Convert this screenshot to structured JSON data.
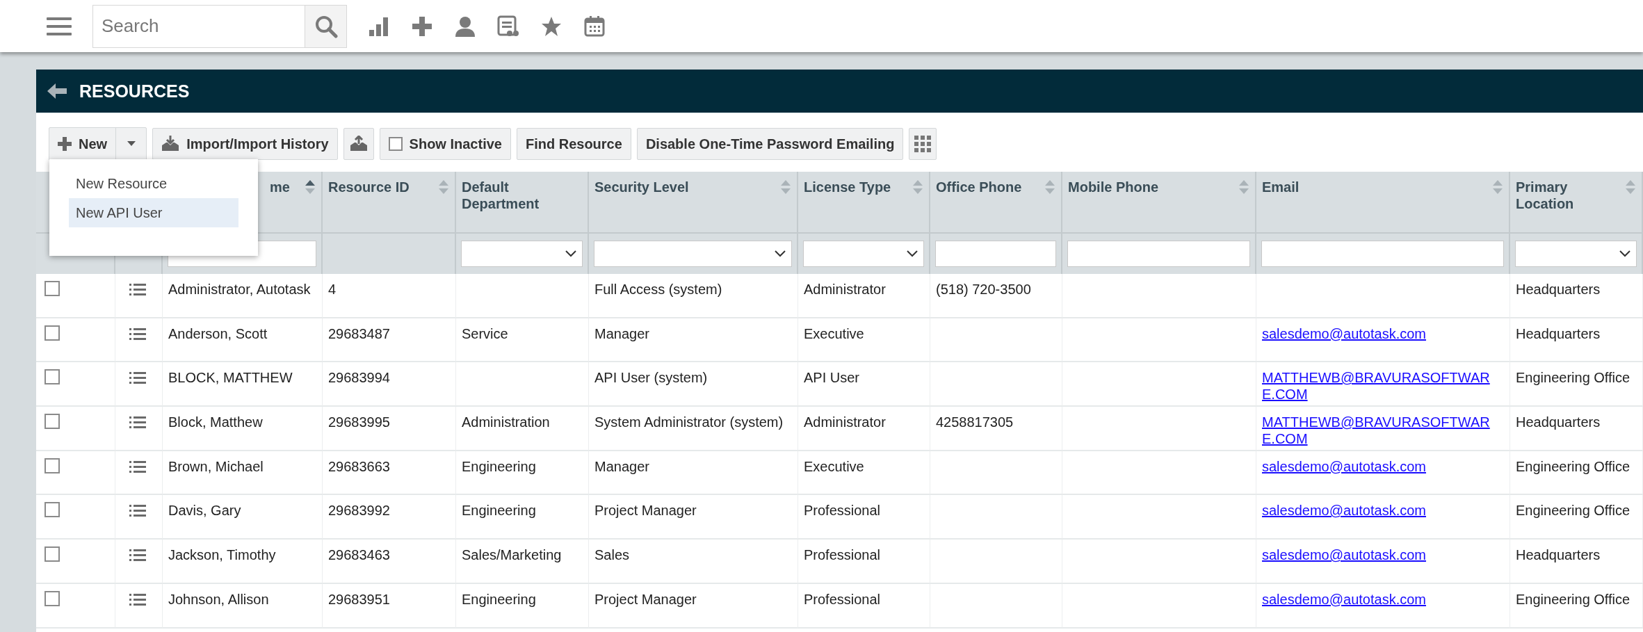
{
  "topbar": {
    "search": {
      "placeholder": "Search"
    }
  },
  "panel": {
    "title": "RESOURCES"
  },
  "toolbar": {
    "new_button": {
      "label": "New"
    },
    "import_button": {
      "label": "Import/Import History"
    },
    "show_inactive": {
      "label": "Show Inactive",
      "checked": false
    },
    "find_button": {
      "label": "Find Resource"
    },
    "disable_button": {
      "label": "Disable One-Time Password Emailing"
    }
  },
  "new_menu": {
    "open": true,
    "items": [
      {
        "label": "New Resource",
        "selected": false
      },
      {
        "label": "New API User",
        "selected": true
      }
    ]
  },
  "table": {
    "columns": [
      {
        "label": "me",
        "sortable": true,
        "sorted": true,
        "kind": "text"
      },
      {
        "label": "Resource ID",
        "sortable": true,
        "sorted": false,
        "kind": "none"
      },
      {
        "label": "Default Department",
        "sortable": false,
        "kind": "select"
      },
      {
        "label": "Security Level",
        "sortable": true,
        "sorted": false,
        "kind": "select"
      },
      {
        "label": "License Type",
        "sortable": true,
        "sorted": false,
        "kind": "select"
      },
      {
        "label": "Office Phone",
        "sortable": true,
        "sorted": false,
        "kind": "text"
      },
      {
        "label": "Mobile Phone",
        "sortable": true,
        "sorted": false,
        "kind": "text"
      },
      {
        "label": "Email",
        "sortable": true,
        "sorted": false,
        "kind": "text"
      },
      {
        "label": "Primary Location",
        "sortable": true,
        "sorted": false,
        "kind": "select"
      }
    ],
    "rows": [
      {
        "checked": false,
        "cells": [
          "Administrator, Autotask",
          "4",
          "",
          "Full Access (system)",
          "Administrator",
          "(518) 720-3500",
          "",
          "",
          "Headquarters"
        ]
      },
      {
        "checked": false,
        "cells": [
          "Anderson, Scott",
          "29683487",
          "Service",
          "Manager",
          "Executive",
          "",
          "",
          "salesdemo@autotask.com",
          "Headquarters"
        ]
      },
      {
        "checked": false,
        "cells": [
          "BLOCK, MATTHEW",
          "29683994",
          "",
          "API User (system)",
          "API User",
          "",
          "",
          "MATTHEWB@BRAVURASOFTWARE.COM",
          "Engineering Office"
        ]
      },
      {
        "checked": false,
        "cells": [
          "Block, Matthew",
          "29683995",
          "Administration",
          "System Administrator (system)",
          "Administrator",
          "4258817305",
          "",
          "MATTHEWB@BRAVURASOFTWARE.COM",
          "Headquarters"
        ]
      },
      {
        "checked": false,
        "cells": [
          "Brown, Michael",
          "29683663",
          "Engineering",
          "Manager",
          "Executive",
          "",
          "",
          "salesdemo@autotask.com",
          "Engineering Office"
        ]
      },
      {
        "checked": false,
        "cells": [
          "Davis, Gary",
          "29683992",
          "Engineering",
          "Project Manager",
          "Professional",
          "",
          "",
          "salesdemo@autotask.com",
          "Engineering Office"
        ]
      },
      {
        "checked": false,
        "cells": [
          "Jackson, Timothy",
          "29683463",
          "Sales/Marketing",
          "Sales",
          "Professional",
          "",
          "",
          "salesdemo@autotask.com",
          "Headquarters"
        ]
      },
      {
        "checked": false,
        "cells": [
          "Johnson, Allison",
          "29683951",
          "Engineering",
          "Project Manager",
          "Professional",
          "",
          "",
          "salesdemo@autotask.com",
          "Engineering Office"
        ]
      }
    ]
  }
}
